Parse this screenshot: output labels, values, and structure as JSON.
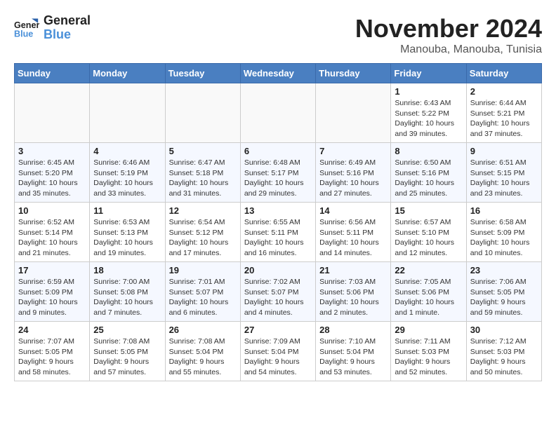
{
  "header": {
    "logo_line1": "General",
    "logo_line2": "Blue",
    "month": "November 2024",
    "location": "Manouba, Manouba, Tunisia"
  },
  "weekdays": [
    "Sunday",
    "Monday",
    "Tuesday",
    "Wednesday",
    "Thursday",
    "Friday",
    "Saturday"
  ],
  "weeks": [
    [
      {
        "day": "",
        "info": ""
      },
      {
        "day": "",
        "info": ""
      },
      {
        "day": "",
        "info": ""
      },
      {
        "day": "",
        "info": ""
      },
      {
        "day": "",
        "info": ""
      },
      {
        "day": "1",
        "info": "Sunrise: 6:43 AM\nSunset: 5:22 PM\nDaylight: 10 hours and 39 minutes."
      },
      {
        "day": "2",
        "info": "Sunrise: 6:44 AM\nSunset: 5:21 PM\nDaylight: 10 hours and 37 minutes."
      }
    ],
    [
      {
        "day": "3",
        "info": "Sunrise: 6:45 AM\nSunset: 5:20 PM\nDaylight: 10 hours and 35 minutes."
      },
      {
        "day": "4",
        "info": "Sunrise: 6:46 AM\nSunset: 5:19 PM\nDaylight: 10 hours and 33 minutes."
      },
      {
        "day": "5",
        "info": "Sunrise: 6:47 AM\nSunset: 5:18 PM\nDaylight: 10 hours and 31 minutes."
      },
      {
        "day": "6",
        "info": "Sunrise: 6:48 AM\nSunset: 5:17 PM\nDaylight: 10 hours and 29 minutes."
      },
      {
        "day": "7",
        "info": "Sunrise: 6:49 AM\nSunset: 5:16 PM\nDaylight: 10 hours and 27 minutes."
      },
      {
        "day": "8",
        "info": "Sunrise: 6:50 AM\nSunset: 5:16 PM\nDaylight: 10 hours and 25 minutes."
      },
      {
        "day": "9",
        "info": "Sunrise: 6:51 AM\nSunset: 5:15 PM\nDaylight: 10 hours and 23 minutes."
      }
    ],
    [
      {
        "day": "10",
        "info": "Sunrise: 6:52 AM\nSunset: 5:14 PM\nDaylight: 10 hours and 21 minutes."
      },
      {
        "day": "11",
        "info": "Sunrise: 6:53 AM\nSunset: 5:13 PM\nDaylight: 10 hours and 19 minutes."
      },
      {
        "day": "12",
        "info": "Sunrise: 6:54 AM\nSunset: 5:12 PM\nDaylight: 10 hours and 17 minutes."
      },
      {
        "day": "13",
        "info": "Sunrise: 6:55 AM\nSunset: 5:11 PM\nDaylight: 10 hours and 16 minutes."
      },
      {
        "day": "14",
        "info": "Sunrise: 6:56 AM\nSunset: 5:11 PM\nDaylight: 10 hours and 14 minutes."
      },
      {
        "day": "15",
        "info": "Sunrise: 6:57 AM\nSunset: 5:10 PM\nDaylight: 10 hours and 12 minutes."
      },
      {
        "day": "16",
        "info": "Sunrise: 6:58 AM\nSunset: 5:09 PM\nDaylight: 10 hours and 10 minutes."
      }
    ],
    [
      {
        "day": "17",
        "info": "Sunrise: 6:59 AM\nSunset: 5:09 PM\nDaylight: 10 hours and 9 minutes."
      },
      {
        "day": "18",
        "info": "Sunrise: 7:00 AM\nSunset: 5:08 PM\nDaylight: 10 hours and 7 minutes."
      },
      {
        "day": "19",
        "info": "Sunrise: 7:01 AM\nSunset: 5:07 PM\nDaylight: 10 hours and 6 minutes."
      },
      {
        "day": "20",
        "info": "Sunrise: 7:02 AM\nSunset: 5:07 PM\nDaylight: 10 hours and 4 minutes."
      },
      {
        "day": "21",
        "info": "Sunrise: 7:03 AM\nSunset: 5:06 PM\nDaylight: 10 hours and 2 minutes."
      },
      {
        "day": "22",
        "info": "Sunrise: 7:05 AM\nSunset: 5:06 PM\nDaylight: 10 hours and 1 minute."
      },
      {
        "day": "23",
        "info": "Sunrise: 7:06 AM\nSunset: 5:05 PM\nDaylight: 9 hours and 59 minutes."
      }
    ],
    [
      {
        "day": "24",
        "info": "Sunrise: 7:07 AM\nSunset: 5:05 PM\nDaylight: 9 hours and 58 minutes."
      },
      {
        "day": "25",
        "info": "Sunrise: 7:08 AM\nSunset: 5:05 PM\nDaylight: 9 hours and 57 minutes."
      },
      {
        "day": "26",
        "info": "Sunrise: 7:08 AM\nSunset: 5:04 PM\nDaylight: 9 hours and 55 minutes."
      },
      {
        "day": "27",
        "info": "Sunrise: 7:09 AM\nSunset: 5:04 PM\nDaylight: 9 hours and 54 minutes."
      },
      {
        "day": "28",
        "info": "Sunrise: 7:10 AM\nSunset: 5:04 PM\nDaylight: 9 hours and 53 minutes."
      },
      {
        "day": "29",
        "info": "Sunrise: 7:11 AM\nSunset: 5:03 PM\nDaylight: 9 hours and 52 minutes."
      },
      {
        "day": "30",
        "info": "Sunrise: 7:12 AM\nSunset: 5:03 PM\nDaylight: 9 hours and 50 minutes."
      }
    ]
  ]
}
